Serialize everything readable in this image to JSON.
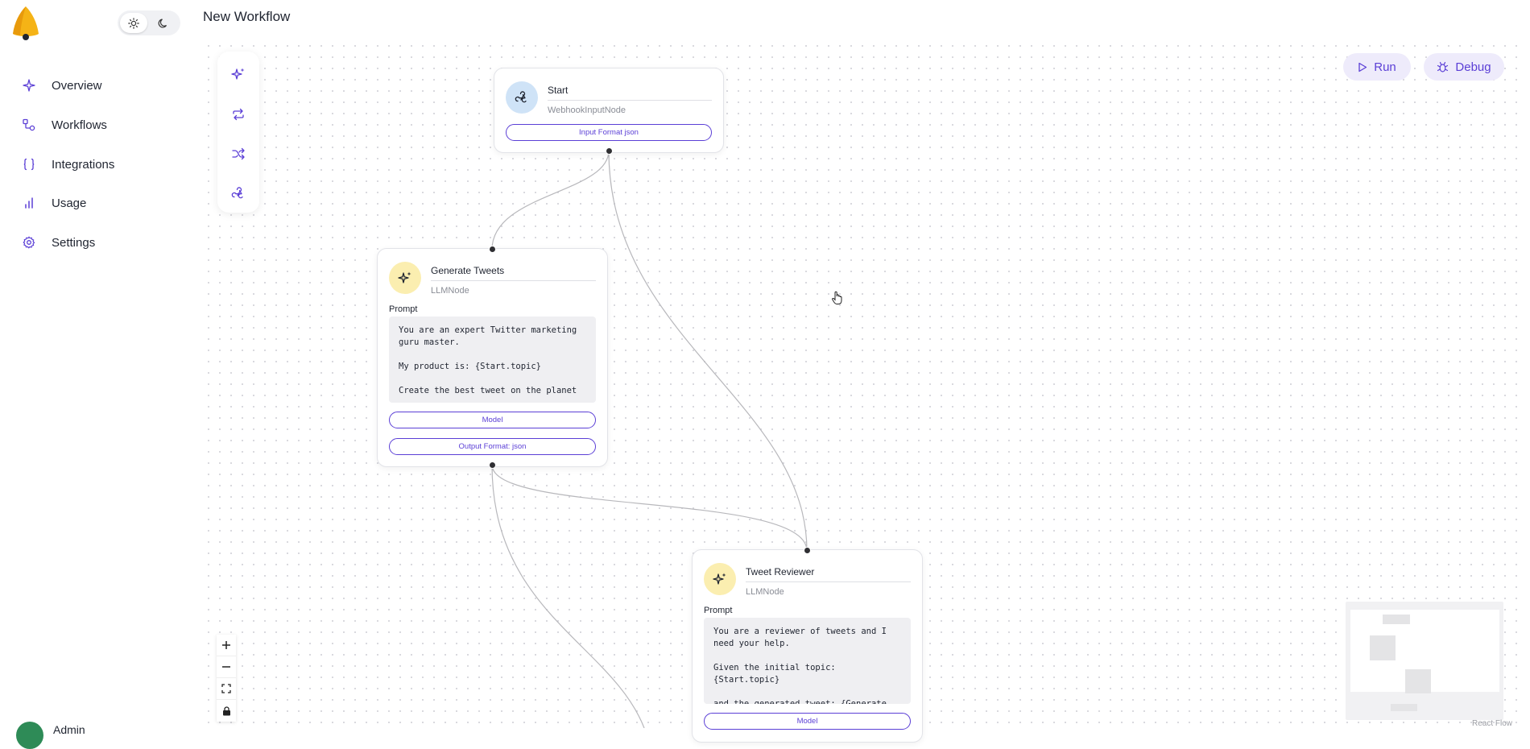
{
  "app": {
    "theme_light_icon": "sun-icon",
    "theme_dark_icon": "moon-icon"
  },
  "sidebar": {
    "items": [
      {
        "label": "Overview",
        "icon": "sparkle-icon"
      },
      {
        "label": "Workflows",
        "icon": "workflow-icon"
      },
      {
        "label": "Integrations",
        "icon": "braces-icon"
      },
      {
        "label": "Usage",
        "icon": "bar-chart-icon"
      },
      {
        "label": "Settings",
        "icon": "gear-icon"
      }
    ],
    "user_name": "Admin"
  },
  "header": {
    "title": "New Workflow"
  },
  "actions": {
    "run_label": "Run",
    "debug_label": "Debug"
  },
  "colors": {
    "accent": "#5b3fd6",
    "accent_bg": "#eeebfb",
    "webhook_icon_bg": "#cfe3f7",
    "llm_icon_bg": "#fbeeb0"
  },
  "nodes": {
    "start": {
      "title": "Start",
      "type": "WebhookInputNode",
      "button": "Input Format json"
    },
    "generate": {
      "title": "Generate Tweets",
      "type": "LLMNode",
      "prompt_label": "Prompt",
      "prompt": "You are an expert Twitter marketing\nguru master.\n\nMy product is: {Start.topic}\n\nCreate the best tweet on the planet …",
      "model_button": "Model",
      "format_button": "Output Format: json"
    },
    "reviewer": {
      "title": "Tweet Reviewer",
      "type": "LLMNode",
      "prompt_label": "Prompt",
      "prompt": "You are a reviewer of tweets and I\nneed your help.\n\nGiven the initial topic: {Start.topic}\n\nand the generated tweet: {Generate …",
      "model_button": "Model"
    }
  },
  "canvas": {
    "attribution": "React Flow"
  }
}
